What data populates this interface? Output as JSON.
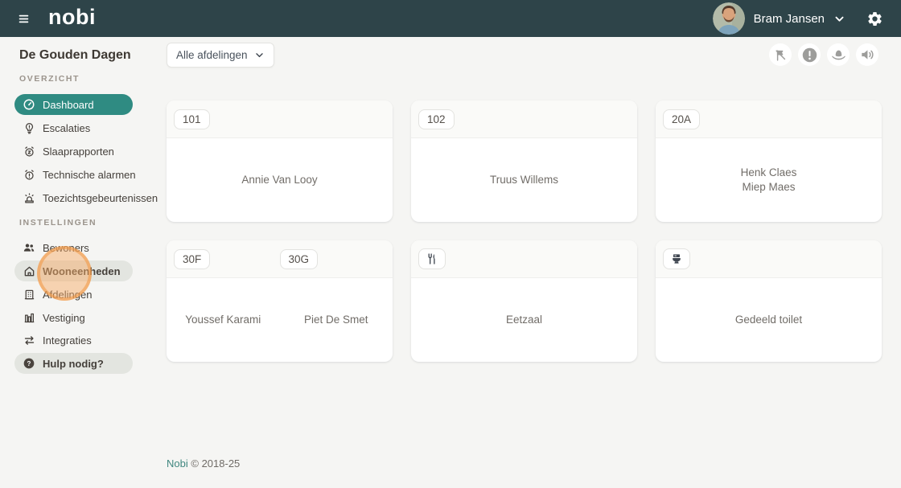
{
  "topbar": {
    "logo": "nobi",
    "user_name": "Bram Jansen"
  },
  "header": {
    "title": "De Gouden Dagen",
    "filter_value": "Alle afdelingen"
  },
  "action_icons": [
    "flag-off-icon",
    "alert-circle-icon",
    "hat-icon",
    "volume-icon"
  ],
  "sidebar": {
    "sections": [
      {
        "label": "OVERZICHT",
        "items": [
          {
            "label": "Dashboard",
            "icon": "gauge-icon",
            "active": true
          },
          {
            "label": "Escalaties",
            "icon": "bulb-alert-icon"
          },
          {
            "label": "Slaaprapporten",
            "icon": "alarm-sleep-icon"
          },
          {
            "label": "Technische alarmen",
            "icon": "alarm-alert-icon"
          },
          {
            "label": "Toezichtsgebeurtenissen",
            "icon": "siren-icon"
          }
        ]
      },
      {
        "label": "INSTELLINGEN",
        "items": [
          {
            "label": "Bewoners",
            "icon": "users-icon"
          },
          {
            "label": "Wooneenheden",
            "icon": "home-icon",
            "hovered": true
          },
          {
            "label": "Afdelingen",
            "icon": "building-icon"
          },
          {
            "label": "Vestiging",
            "icon": "factory-icon"
          },
          {
            "label": "Integraties",
            "icon": "swap-arrows-icon"
          }
        ]
      }
    ],
    "help_label": "Hulp nodig?"
  },
  "cards": [
    {
      "badges": [
        "101"
      ],
      "names": [
        "Annie Van Looy"
      ]
    },
    {
      "badges": [
        "102"
      ],
      "names": [
        "Truus Willems"
      ]
    },
    {
      "badges": [
        "20A"
      ],
      "names": [
        "Henk Claes",
        "Miep Maes"
      ]
    },
    {
      "badges": [
        "30F",
        "30G"
      ],
      "names": [
        "Youssef Karami",
        "Piet De Smet"
      ]
    },
    {
      "badges": [],
      "icon": "utensils-icon",
      "names": [
        "Eetzaal"
      ]
    },
    {
      "badges": [],
      "icon": "toilet-icon",
      "names": [
        "Gedeeld toilet"
      ]
    }
  ],
  "footer": {
    "brand": "Nobi",
    "copyright": "© 2018-25"
  },
  "colors": {
    "topbar_bg": "#2e4449",
    "accent_teal": "#2f8b82",
    "sidebar_hover": "#e3e5e0",
    "highlight_orange": "#f09642",
    "page_bg": "#f5f5f3"
  }
}
